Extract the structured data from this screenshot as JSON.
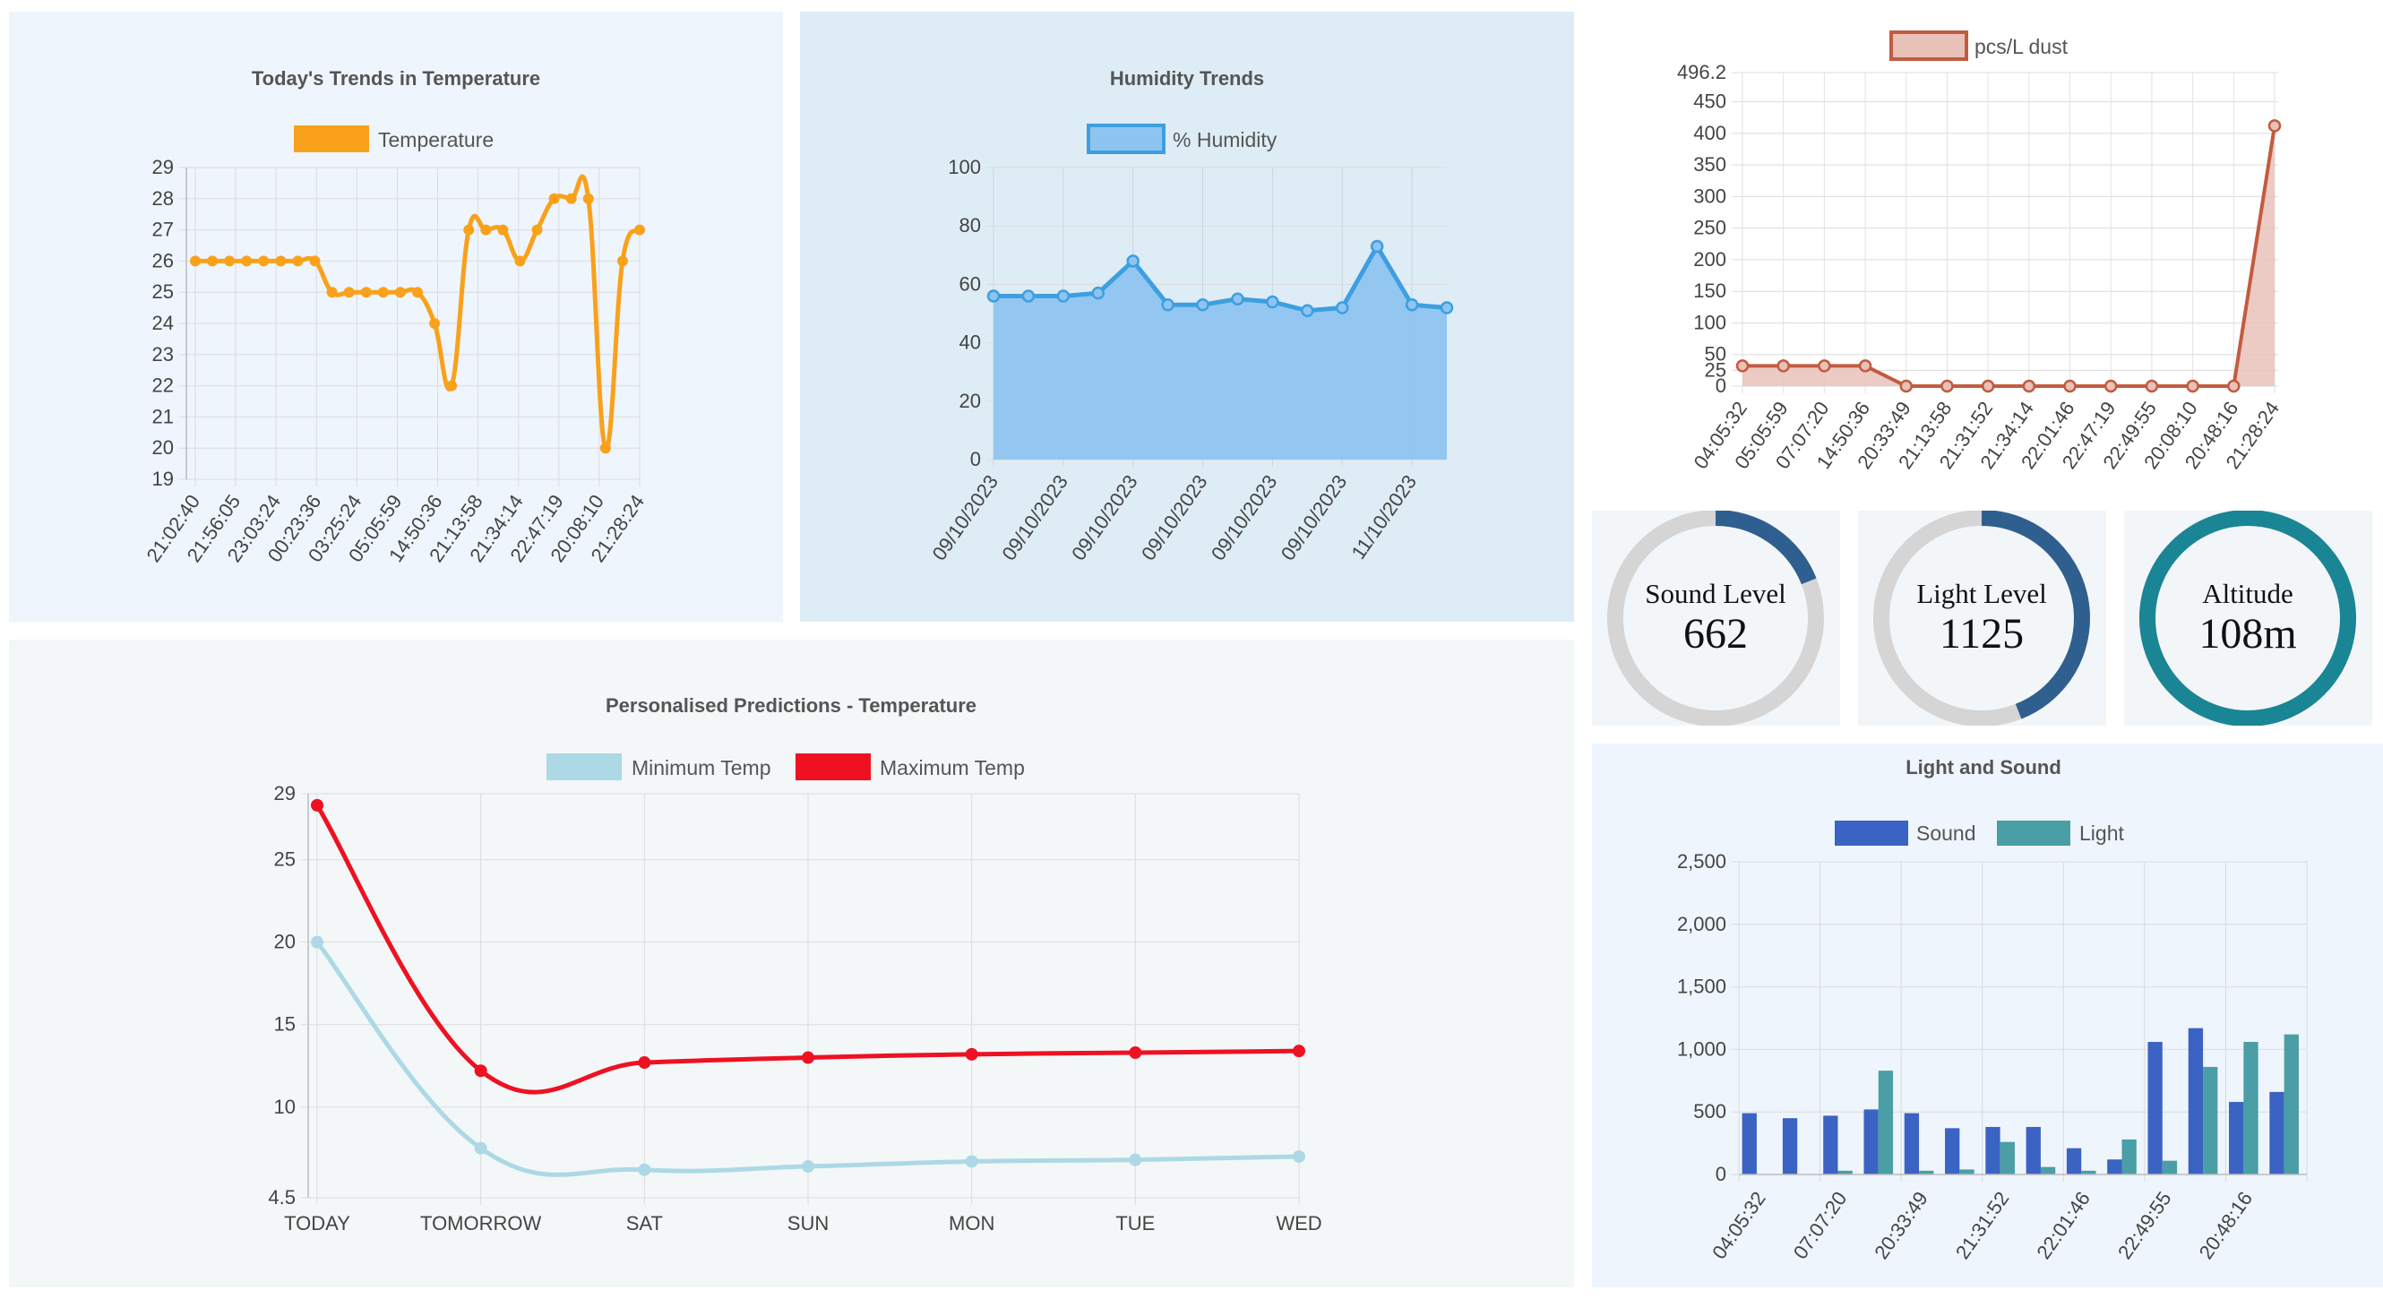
{
  "temperature_chart": {
    "title": "Today's Trends in Temperature",
    "legend": "Temperature",
    "color": "#f9a11b"
  },
  "humidity_chart": {
    "title": "Humidity Trends",
    "legend": "% Humidity",
    "color": "#3d9fe0",
    "fill": "#8ec5f0"
  },
  "dust_chart": {
    "legend": "pcs/L dust",
    "color": "#c25b40",
    "fill": "#e8c2b8"
  },
  "predictions_chart": {
    "title": "Personalised Predictions - Temperature",
    "min_color": "#add8e6",
    "max_color": "#ee1122"
  },
  "light_sound_chart": {
    "title": "Light and Sound",
    "sound_color": "#3b63c4",
    "light_color": "#4a9ea6"
  },
  "gauges": [
    {
      "label": "Sound Level",
      "value": "662",
      "fraction": 0.19,
      "color": "#2f5f8f"
    },
    {
      "label": "Light Level",
      "value": "1125",
      "fraction": 0.44,
      "color": "#2f5f8f"
    },
    {
      "label": "Altitude",
      "value": "108m",
      "fraction": 1.0,
      "color": "#1a8595"
    }
  ],
  "chart_data": [
    {
      "type": "line",
      "title": "Today's Trends in Temperature",
      "series": [
        {
          "name": "Temperature",
          "values": [
            26,
            26,
            26,
            26,
            26,
            26,
            26,
            26,
            25,
            25,
            25,
            25,
            25,
            25,
            24,
            22,
            27,
            27,
            27,
            26,
            27,
            28,
            28,
            28,
            20,
            26,
            27
          ]
        }
      ],
      "x_ticks": [
        "21:02:40",
        "21:56:05",
        "23:03:24",
        "00:23:36",
        "03:25:24",
        "05:05:59",
        "14:50:36",
        "21:13:58",
        "21:34:14",
        "22:47:19",
        "20:08:10",
        "21:28:24"
      ],
      "y_ticks": [
        "19",
        "20",
        "21",
        "22",
        "23",
        "24",
        "25",
        "26",
        "27",
        "28",
        "29"
      ],
      "ylim": [
        19,
        29
      ]
    },
    {
      "type": "area",
      "title": "Humidity Trends",
      "series": [
        {
          "name": "% Humidity",
          "values": [
            56,
            56,
            56,
            57,
            68,
            53,
            53,
            55,
            54,
            51,
            52,
            73,
            53,
            52
          ]
        }
      ],
      "x_ticks": [
        "09/10/2023",
        "09/10/2023",
        "09/10/2023",
        "09/10/2023",
        "09/10/2023",
        "09/10/2023",
        "11/10/2023"
      ],
      "y_ticks": [
        "0",
        "20",
        "40",
        "60",
        "80",
        "100"
      ],
      "ylim": [
        0,
        100
      ]
    },
    {
      "type": "area",
      "series": [
        {
          "name": "pcs/L dust",
          "values": [
            32,
            32,
            32,
            32,
            0,
            0,
            0,
            0,
            0,
            0,
            0,
            0,
            0,
            412
          ]
        }
      ],
      "categories": [
        "04:05:32",
        "05:05:59",
        "07:07:20",
        "14:50:36",
        "20:33:49",
        "21:13:58",
        "21:31:52",
        "21:34:14",
        "22:01:46",
        "22:47:19",
        "22:49:55",
        "20:08:10",
        "20:48:16",
        "21:28:24"
      ],
      "y_ticks": [
        "0",
        "25",
        "50",
        "100",
        "150",
        "200",
        "250",
        "300",
        "350",
        "400",
        "450",
        "496.2"
      ],
      "ylim": [
        0,
        496.2
      ]
    },
    {
      "type": "line",
      "title": "Personalised Predictions - Temperature",
      "categories": [
        "TODAY",
        "TOMORROW",
        "SAT",
        "SUN",
        "MON",
        "TUE",
        "WED"
      ],
      "series": [
        {
          "name": "Minimum Temp",
          "values": [
            20,
            7.5,
            6.2,
            6.4,
            6.7,
            6.8,
            7.0
          ]
        },
        {
          "name": "Maximum Temp",
          "values": [
            28.3,
            12.2,
            12.7,
            13.0,
            13.2,
            13.3,
            13.4
          ]
        }
      ],
      "y_ticks": [
        "4.5",
        "10",
        "15",
        "20",
        "25",
        "29"
      ],
      "ylim": [
        4.5,
        29
      ]
    },
    {
      "type": "bar",
      "title": "Light and Sound",
      "categories": [
        "04:05:32",
        "05:05:59",
        "07:07:20",
        "14:50:36",
        "20:33:49",
        "21:13:58",
        "21:31:52",
        "21:34:14",
        "22:01:46",
        "22:47:19",
        "22:49:55",
        "20:08:10",
        "20:48:16",
        "21:28:24"
      ],
      "x_ticks": [
        "04:05:32",
        "07:07:20",
        "20:33:49",
        "21:31:52",
        "22:01:46",
        "22:49:55",
        "20:48:16"
      ],
      "series": [
        {
          "name": "Sound",
          "values": [
            490,
            450,
            470,
            520,
            490,
            370,
            380,
            380,
            210,
            120,
            1060,
            1170,
            580,
            660
          ]
        },
        {
          "name": "Light",
          "values": [
            0,
            0,
            30,
            830,
            30,
            40,
            260,
            60,
            30,
            280,
            110,
            860,
            1060,
            1120
          ]
        }
      ],
      "y_ticks": [
        "0",
        "500",
        "1,000",
        "1,500",
        "2,000",
        "2,500"
      ],
      "ylim": [
        0,
        2500
      ]
    }
  ]
}
